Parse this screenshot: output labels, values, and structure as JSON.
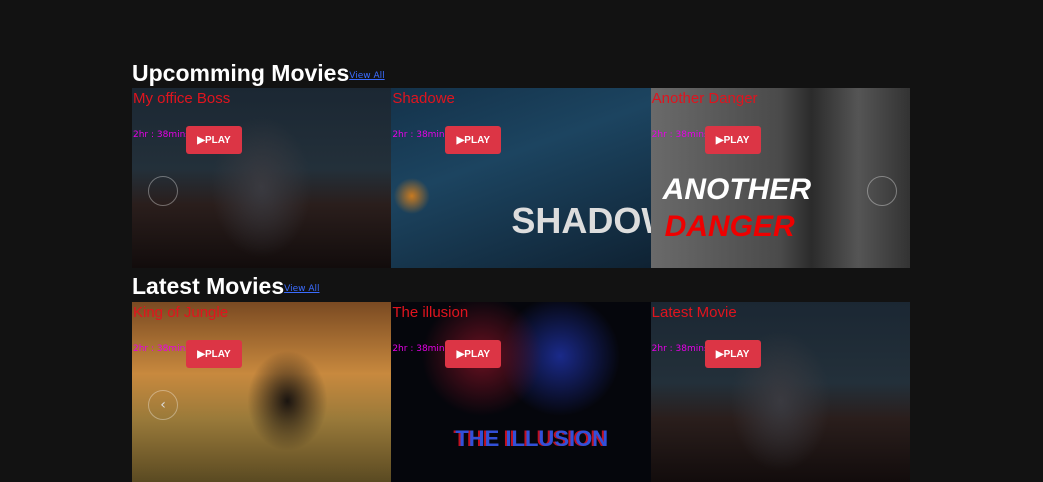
{
  "sections": [
    {
      "title": "Upcomming Movies",
      "view_all": "View All",
      "movies": [
        {
          "title": "My office Boss",
          "duration": "2hr : 38mins",
          "play": "▶PLAY"
        },
        {
          "title": "Shadowe",
          "duration": "2hr : 38mins",
          "play": "▶PLAY",
          "poster_text": "SHADOWE"
        },
        {
          "title": "Another Danger",
          "duration": "2hr : 38mins",
          "play": "▶PLAY",
          "poster_text": [
            "ANOTHER",
            "DANGER"
          ]
        }
      ]
    },
    {
      "title": "Latest Movies",
      "view_all": "View All",
      "movies": [
        {
          "title": "King of Jungle",
          "duration": "2hr : 38mins",
          "play": "▶PLAY"
        },
        {
          "title": "The illusion",
          "duration": "2hr : 38mins",
          "play": "▶PLAY",
          "poster_text": "THE ILLUSION"
        },
        {
          "title": "Latest Movie",
          "duration": "2hr : 38mins",
          "play": "▶PLAY"
        }
      ]
    }
  ],
  "colors": {
    "background": "#121212",
    "title": "#e0141e",
    "duration": "#e600e6",
    "play_button": "#dc3545",
    "link": "#3b6cff"
  }
}
